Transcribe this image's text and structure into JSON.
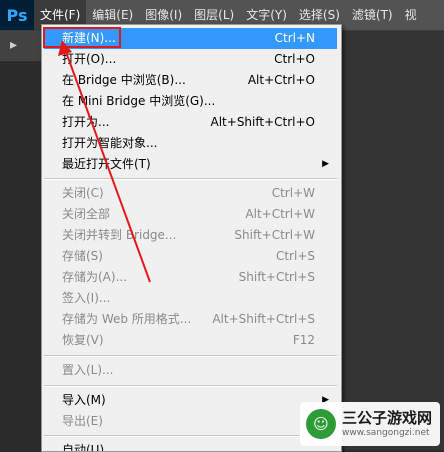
{
  "app": {
    "logo": "Ps"
  },
  "menubar": {
    "items": [
      "文件(F)",
      "编辑(E)",
      "图像(I)",
      "图层(L)",
      "文字(Y)",
      "选择(S)",
      "滤镜(T)",
      "视"
    ]
  },
  "dropdown": {
    "items": [
      {
        "label": "新建(N)...",
        "shortcut": "Ctrl+N"
      },
      {
        "label": "打开(O)...",
        "shortcut": "Ctrl+O"
      },
      {
        "label": "在 Bridge 中浏览(B)...",
        "shortcut": "Alt+Ctrl+O"
      },
      {
        "label": "在 Mini Bridge 中浏览(G)...",
        "shortcut": ""
      },
      {
        "label": "打开为...",
        "shortcut": "Alt+Shift+Ctrl+O"
      },
      {
        "label": "打开为智能对象...",
        "shortcut": ""
      },
      {
        "label": "最近打开文件(T)",
        "shortcut": ""
      },
      {
        "label": "关闭(C)",
        "shortcut": "Ctrl+W"
      },
      {
        "label": "关闭全部",
        "shortcut": "Alt+Ctrl+W"
      },
      {
        "label": "关闭并转到 Bridge...",
        "shortcut": "Shift+Ctrl+W"
      },
      {
        "label": "存储(S)",
        "shortcut": "Ctrl+S"
      },
      {
        "label": "存储为(A)...",
        "shortcut": "Shift+Ctrl+S"
      },
      {
        "label": "签入(I)...",
        "shortcut": ""
      },
      {
        "label": "存储为 Web 所用格式...",
        "shortcut": "Alt+Shift+Ctrl+S"
      },
      {
        "label": "恢复(V)",
        "shortcut": "F12"
      },
      {
        "label": "置入(L)...",
        "shortcut": ""
      },
      {
        "label": "导入(M)",
        "shortcut": ""
      },
      {
        "label": "导出(E)",
        "shortcut": ""
      },
      {
        "label": "自动(U)",
        "shortcut": ""
      }
    ]
  },
  "watermark": {
    "title": "三公子游戏网",
    "url": "www.sangongzi.net"
  },
  "colors": {
    "highlight": "#3399ff",
    "annotation": "#e31818"
  }
}
